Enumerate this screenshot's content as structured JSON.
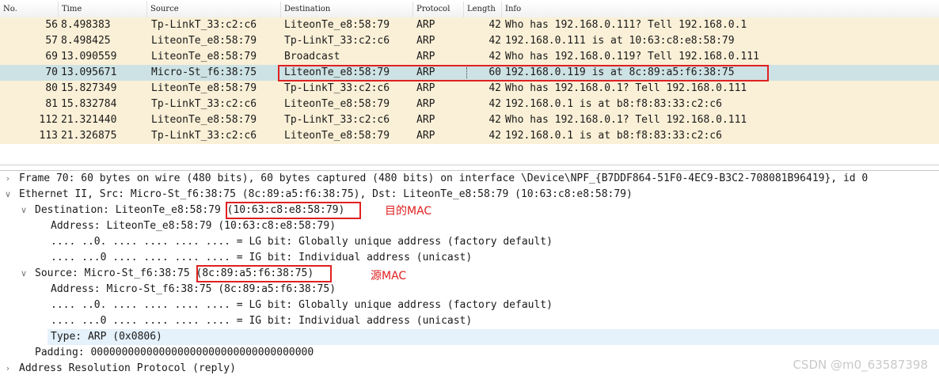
{
  "columns": [
    {
      "key": "no",
      "label": "No."
    },
    {
      "key": "time",
      "label": "Time"
    },
    {
      "key": "source",
      "label": "Source"
    },
    {
      "key": "destination",
      "label": "Destination"
    },
    {
      "key": "protocol",
      "label": "Protocol"
    },
    {
      "key": "length",
      "label": "Length"
    },
    {
      "key": "info",
      "label": "Info"
    }
  ],
  "packets": [
    {
      "no": "56",
      "time": "8.498383",
      "source": "Tp-LinkT_33:c2:c6",
      "destination": "LiteonTe_e8:58:79",
      "protocol": "ARP",
      "length": "42",
      "info": "Who has 192.168.0.111? Tell 192.168.0.1"
    },
    {
      "no": "57",
      "time": "8.498425",
      "source": "LiteonTe_e8:58:79",
      "destination": "Tp-LinkT_33:c2:c6",
      "protocol": "ARP",
      "length": "42",
      "info": "192.168.0.111 is at 10:63:c8:e8:58:79"
    },
    {
      "no": "69",
      "time": "13.090559",
      "source": "LiteonTe_e8:58:79",
      "destination": "Broadcast",
      "protocol": "ARP",
      "length": "42",
      "info": "Who has 192.168.0.119? Tell 192.168.0.111"
    },
    {
      "no": "70",
      "time": "13.095671",
      "source": "Micro-St_f6:38:75",
      "destination": "LiteonTe_e8:58:79",
      "protocol": "ARP",
      "length": "60",
      "info": "192.168.0.119 is at 8c:89:a5:f6:38:75",
      "selected": true
    },
    {
      "no": "80",
      "time": "15.827349",
      "source": "LiteonTe_e8:58:79",
      "destination": "Tp-LinkT_33:c2:c6",
      "protocol": "ARP",
      "length": "42",
      "info": "Who has 192.168.0.1? Tell 192.168.0.111"
    },
    {
      "no": "81",
      "time": "15.832784",
      "source": "Tp-LinkT_33:c2:c6",
      "destination": "LiteonTe_e8:58:79",
      "protocol": "ARP",
      "length": "42",
      "info": "192.168.0.1 is at b8:f8:83:33:c2:c6"
    },
    {
      "no": "112",
      "time": "21.321440",
      "source": "LiteonTe_e8:58:79",
      "destination": "Tp-LinkT_33:c2:c6",
      "protocol": "ARP",
      "length": "42",
      "info": "Who has 192.168.0.1? Tell 192.168.0.111"
    },
    {
      "no": "113",
      "time": "21.326875",
      "source": "Tp-LinkT_33:c2:c6",
      "destination": "LiteonTe_e8:58:79",
      "protocol": "ARP",
      "length": "42",
      "info": "192.168.0.1 is at b8:f8:83:33:c2:c6"
    }
  ],
  "details": [
    {
      "indent": 0,
      "expander": "collapsed",
      "text": "Frame 70: 60 bytes on wire (480 bits), 60 bytes captured (480 bits) on interface \\Device\\NPF_{B7DDF864-51F0-4EC9-B3C2-708081B96419}, id 0"
    },
    {
      "indent": 0,
      "expander": "expanded",
      "text": "Ethernet II, Src: Micro-St_f6:38:75 (8c:89:a5:f6:38:75), Dst: LiteonTe_e8:58:79 (10:63:c8:e8:58:79)"
    },
    {
      "indent": 1,
      "expander": "expanded",
      "text": "Destination: LiteonTe_e8:58:79 (10:63:c8:e8:58:79)"
    },
    {
      "indent": 2,
      "expander": "none",
      "text": "Address: LiteonTe_e8:58:79 (10:63:c8:e8:58:79)"
    },
    {
      "indent": 2,
      "expander": "none",
      "text": ".... ..0. .... .... .... .... = LG bit: Globally unique address (factory default)"
    },
    {
      "indent": 2,
      "expander": "none",
      "text": ".... ...0 .... .... .... .... = IG bit: Individual address (unicast)"
    },
    {
      "indent": 1,
      "expander": "expanded",
      "text": "Source: Micro-St_f6:38:75 (8c:89:a5:f6:38:75)"
    },
    {
      "indent": 2,
      "expander": "none",
      "text": "Address: Micro-St_f6:38:75 (8c:89:a5:f6:38:75)"
    },
    {
      "indent": 2,
      "expander": "none",
      "text": ".... ..0. .... .... .... .... = LG bit: Globally unique address (factory default)"
    },
    {
      "indent": 2,
      "expander": "none",
      "text": ".... ...0 .... .... .... .... = IG bit: Individual address (unicast)"
    },
    {
      "indent": 1,
      "expander": "none",
      "text": "Type: ARP (0x0806)",
      "selected": true
    },
    {
      "indent": 1,
      "expander": "none",
      "text": "Padding: 000000000000000000000000000000000000"
    },
    {
      "indent": 0,
      "expander": "collapsed",
      "text": "Address Resolution Protocol (reply)"
    }
  ],
  "annotations": {
    "dest_mac_label": "目的MAC",
    "src_mac_label": "源MAC"
  },
  "watermark": "CSDN @m0_63587398",
  "colors": {
    "row_bg": "#faf0d7",
    "selected_row_bg": "#cde2e4",
    "selected_detail_bg": "#e5f1fb",
    "annotation_red": "#e02020"
  }
}
